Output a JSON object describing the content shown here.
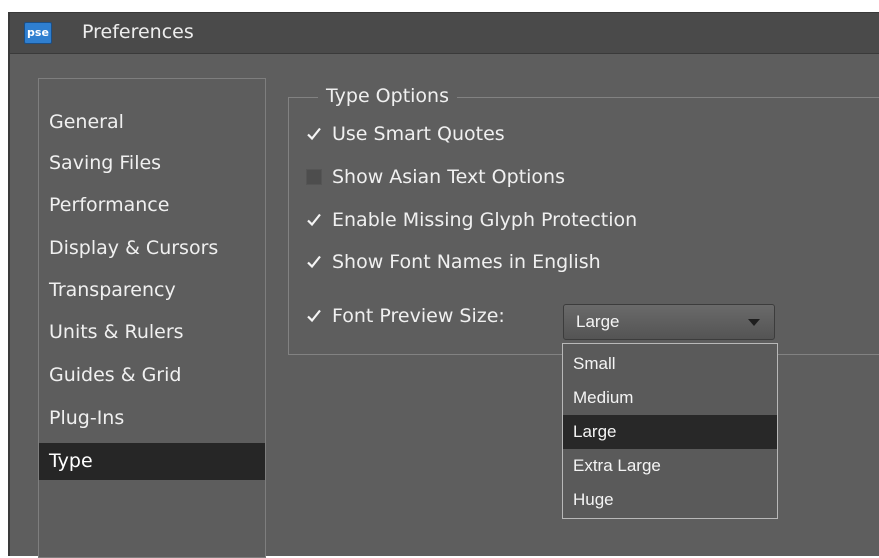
{
  "window": {
    "title": "Preferences",
    "app_icon_label": "pse"
  },
  "sidebar": {
    "items": [
      {
        "label": "General",
        "selected": false
      },
      {
        "label": "Saving Files",
        "selected": false
      },
      {
        "label": "Performance",
        "selected": false
      },
      {
        "label": "Display & Cursors",
        "selected": false
      },
      {
        "label": "Transparency",
        "selected": false
      },
      {
        "label": "Units & Rulers",
        "selected": false
      },
      {
        "label": "Guides & Grid",
        "selected": false
      },
      {
        "label": "Plug-Ins",
        "selected": false
      },
      {
        "label": "Type",
        "selected": true
      }
    ]
  },
  "type_options": {
    "group_title": "Type Options",
    "options": [
      {
        "label": "Use Smart Quotes",
        "checked": true
      },
      {
        "label": "Show Asian Text Options",
        "checked": false
      },
      {
        "label": "Enable Missing Glyph Protection",
        "checked": true
      },
      {
        "label": "Show Font Names in English",
        "checked": true
      },
      {
        "label": "Font Preview Size:",
        "checked": true
      }
    ],
    "font_preview_size": {
      "selected": "Large",
      "options": [
        "Small",
        "Medium",
        "Large",
        "Extra Large",
        "Huge"
      ]
    }
  }
}
